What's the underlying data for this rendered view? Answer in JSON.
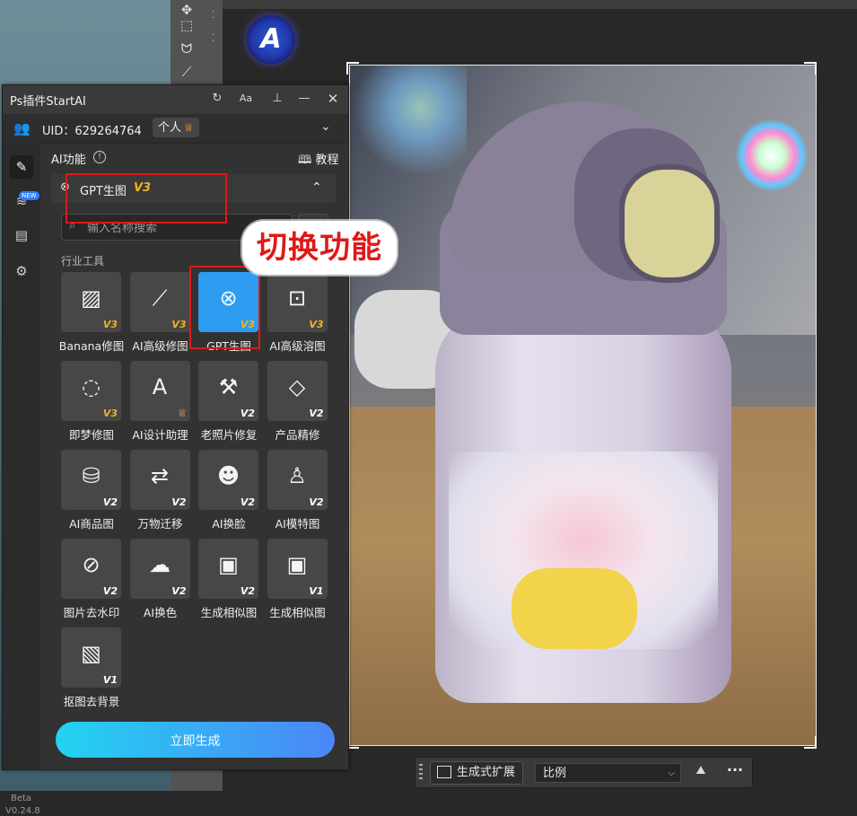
{
  "panel": {
    "title": "Ps插件StartAI",
    "titlebar_icons": [
      "refresh-icon",
      "font-size-icon",
      "pin-icon",
      "minimize-icon",
      "close-icon"
    ],
    "font_btn": "Aa",
    "uid": "UID：629264764",
    "badge": "个人",
    "ai_func": "AI功能",
    "tutorial": "教程",
    "section_title": "GPT生图",
    "section_version": "V3",
    "search_placeholder": "输入名称搜索",
    "industry": "行业工具",
    "sidenav_new": "NEW",
    "beta": "Beta",
    "version": "V0.24.8",
    "generate": "立即生成",
    "accent_color": "#2e9cf0",
    "badge_color": "#f2b31f"
  },
  "tools": [
    {
      "label": "Banana修图",
      "ver": "V3",
      "icon": "image-edit-icon",
      "glyph": "▨"
    },
    {
      "label": "AI高级修图",
      "ver": "V3",
      "icon": "magic-wand-icon",
      "glyph": "⟋"
    },
    {
      "label": "GPT生图",
      "ver": "V3",
      "icon": "gpt-icon",
      "glyph": "⊗",
      "active": true
    },
    {
      "label": "AI高级溶图",
      "ver": "V3",
      "icon": "image-blend-icon",
      "glyph": "⊡"
    },
    {
      "label": "即梦修图",
      "ver": "V3",
      "icon": "planet-icon",
      "glyph": "◌"
    },
    {
      "label": "AI设计助理",
      "ver": "",
      "crown": true,
      "icon": "startai-logo-icon",
      "glyph": "A"
    },
    {
      "label": "老照片修复",
      "ver": "V2",
      "icon": "restore-photo-icon",
      "glyph": "⚒"
    },
    {
      "label": "产品精修",
      "ver": "V2",
      "icon": "diamond-icon",
      "glyph": "◇"
    },
    {
      "label": "AI商品图",
      "ver": "V2",
      "icon": "shopping-bag-icon",
      "glyph": "⛁"
    },
    {
      "label": "万物迁移",
      "ver": "V2",
      "icon": "transfer-icon",
      "glyph": "⇄"
    },
    {
      "label": "AI换脸",
      "ver": "V2",
      "icon": "face-swap-icon",
      "glyph": "☻"
    },
    {
      "label": "AI模特图",
      "ver": "V2",
      "icon": "model-icon",
      "glyph": "♙"
    },
    {
      "label": "图片去水印",
      "ver": "V2",
      "icon": "remove-watermark-icon",
      "glyph": "⊘"
    },
    {
      "label": "AI换色",
      "ver": "V2",
      "icon": "recolor-icon",
      "glyph": "☁"
    },
    {
      "label": "生成相似图",
      "ver": "V2",
      "icon": "similar-image-icon",
      "glyph": "▣"
    },
    {
      "label": "生成相似图",
      "ver": "V1",
      "icon": "similar-image-icon",
      "glyph": "▣"
    },
    {
      "label": "抠图去背景",
      "ver": "V1",
      "icon": "remove-background-icon",
      "glyph": "▧"
    }
  ],
  "annotation": {
    "callout": "切换功能",
    "color": "#e01818"
  },
  "ps": {
    "ctx_generate": "生成式扩展",
    "ctx_select": "比例",
    "ctx_more": "···"
  }
}
